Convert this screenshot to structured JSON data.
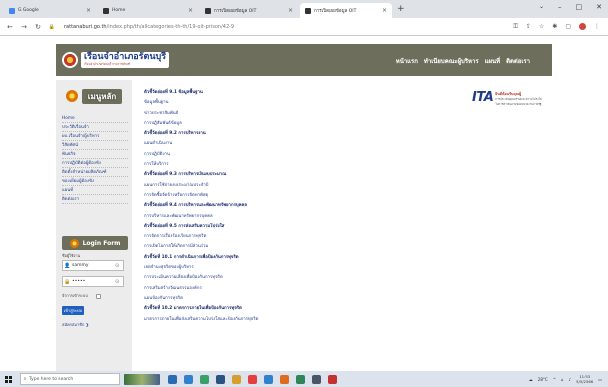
{
  "browser": {
    "tabs": [
      {
        "title": "G  Google",
        "favicon_color": "#4285f4",
        "left": 0
      },
      {
        "title": "Home",
        "favicon_color": "#333333",
        "left": 0
      },
      {
        "title": "การเปิดเผยข้อมูล OIT",
        "favicon_color": "#333333",
        "left": 0
      },
      {
        "title": "การเปิดเผยข้อมูล OIT",
        "favicon_color": "#333333",
        "left": 0,
        "active": true
      }
    ],
    "url_host": "rattanaburi.go.th",
    "url_path": "/index.php/th/allcategories-th-th/19-oit-prison/42-9",
    "new_tab": "+",
    "window_buttons": {
      "minimize": "–",
      "maximize": "□",
      "close": "✕"
    }
  },
  "site": {
    "logo_title": "เรือนจำอำเภอรัตนบุรี",
    "logo_subtitle": "เรือนจำอำเภอรัตนบุรี กรมราชทัณฑ์",
    "nav": [
      "หน้าแรก",
      "ทำเนียบคณะผู้บริหาร",
      "แผนที่",
      "ติดต่อเรา"
    ]
  },
  "sidebar": {
    "menu_title": "เมนูหลัก",
    "items": [
      "Home",
      "ประวัติเรือนจำ",
      "ผบ.เรือนจำ/ผู้บริหาร",
      "วิสัยทัศน์",
      "พันธกิจ",
      "การปฏิบัติต่อผู้ต้องขัง",
      "ติดตั้งจำหน่ายผลิตภัณฑ์",
      "ของเยี่ยมผู้ต้องขัง",
      "แผนที่",
      "ติดต่อเรา"
    ],
    "login": {
      "title": "Login Form",
      "username_label": "ชื่อผู้ใช้งาน",
      "username_value": "sammy",
      "password_value": "•••••",
      "remember_label": "จำการเข้าระบบ",
      "login_button": "เข้าสู่ระบบ",
      "register_link": "สมัครสมาชิก ❯"
    }
  },
  "content": {
    "rows": [
      {
        "text": "ตัวชี้วัดย่อยที่ 9.1 ข้อมูลพื้นฐาน",
        "heading": true
      },
      {
        "text": "ข้อมูลพื้นฐาน",
        "heading": false
      },
      {
        "text": "ข่าวประชาสัมพันธ์",
        "heading": false
      },
      {
        "text": "การปฏิสัมพันธ์ข้อมูล",
        "heading": false
      },
      {
        "text": "ตัวชี้วัดย่อยที่ 9.2 การบริหารงาน",
        "heading": true
      },
      {
        "text": "แผนดำเนินงาน",
        "heading": false
      },
      {
        "text": "การปฏิบัติงาน",
        "heading": false
      },
      {
        "text": "การให้บริการ",
        "heading": false
      },
      {
        "text": "ตัวชี้วัดย่อยที่ 9.3 การบริหารเงินงบประมาณ",
        "heading": true
      },
      {
        "text": "แผนการใช้จ่ายงบประมาณประจำปี",
        "heading": false
      },
      {
        "text": "การจัดซื้อจัดจ้างหรือการจัดหาพัสดุ",
        "heading": false
      },
      {
        "text": "ตัวชี้วัดย่อยที่ 9.4 การบริหารและพัฒนาทรัพยากรบุคคล",
        "heading": true
      },
      {
        "text": "การบริหารและพัฒนาทรัพยากรบุคคล",
        "heading": false
      },
      {
        "text": "ตัวชี้วัดย่อยที่ 9.5 การส่งเสริมความโปร่งใส",
        "heading": true
      },
      {
        "text": "การจัดการเรื่องร้องเรียนการทุจริต",
        "heading": false
      },
      {
        "text": "การเปิดโอกาสให้เกิดการมีส่วนร่วม",
        "heading": false
      },
      {
        "text": "ตัวชี้วัดที่ 10.1 การดำเนินการเพื่อป้องกันการทุจริต",
        "heading": true
      },
      {
        "text": "เจตจำนงสุจริตของผู้บริหาร",
        "heading": false
      },
      {
        "text": "การประเมินความเสี่ยงเพื่อป้องกันการทุจริต",
        "heading": false
      },
      {
        "text": "การเสริมสร้างวัฒนธรรมองค์กร",
        "heading": false
      },
      {
        "text": "แผนป้องกันการทุจริต",
        "heading": false
      },
      {
        "text": "ตัวชี้วัดที่ 10.2 มาตรการภายในเพื่อป้องกันการทุจริต",
        "heading": true
      },
      {
        "text": "มาตรการภายในเพื่อส่งเสริมความโปร่งใสและป้องกันการทุจริต",
        "heading": false
      }
    ]
  },
  "ita": {
    "big": "ITA",
    "line1": "ยินดีต้อนรับคุณผู้",
    "line2": "การประเมินคุณธรรมและความโปร่งใส",
    "line3": "ในการดำเนินงานของหน่วยงานภาครัฐ"
  },
  "taskbar": {
    "search_placeholder": "Type here to search",
    "temperature": "28°C",
    "time": "11:53",
    "date": "5/5/2566",
    "icon_colors": [
      "#2b6cb0",
      "#3182ce",
      "#38a169",
      "#2c5282",
      "#d69e2e",
      "#e53e3e",
      "#3182ce",
      "#dd6b20",
      "#2f855a",
      "#4a5568",
      "#c53030"
    ]
  }
}
